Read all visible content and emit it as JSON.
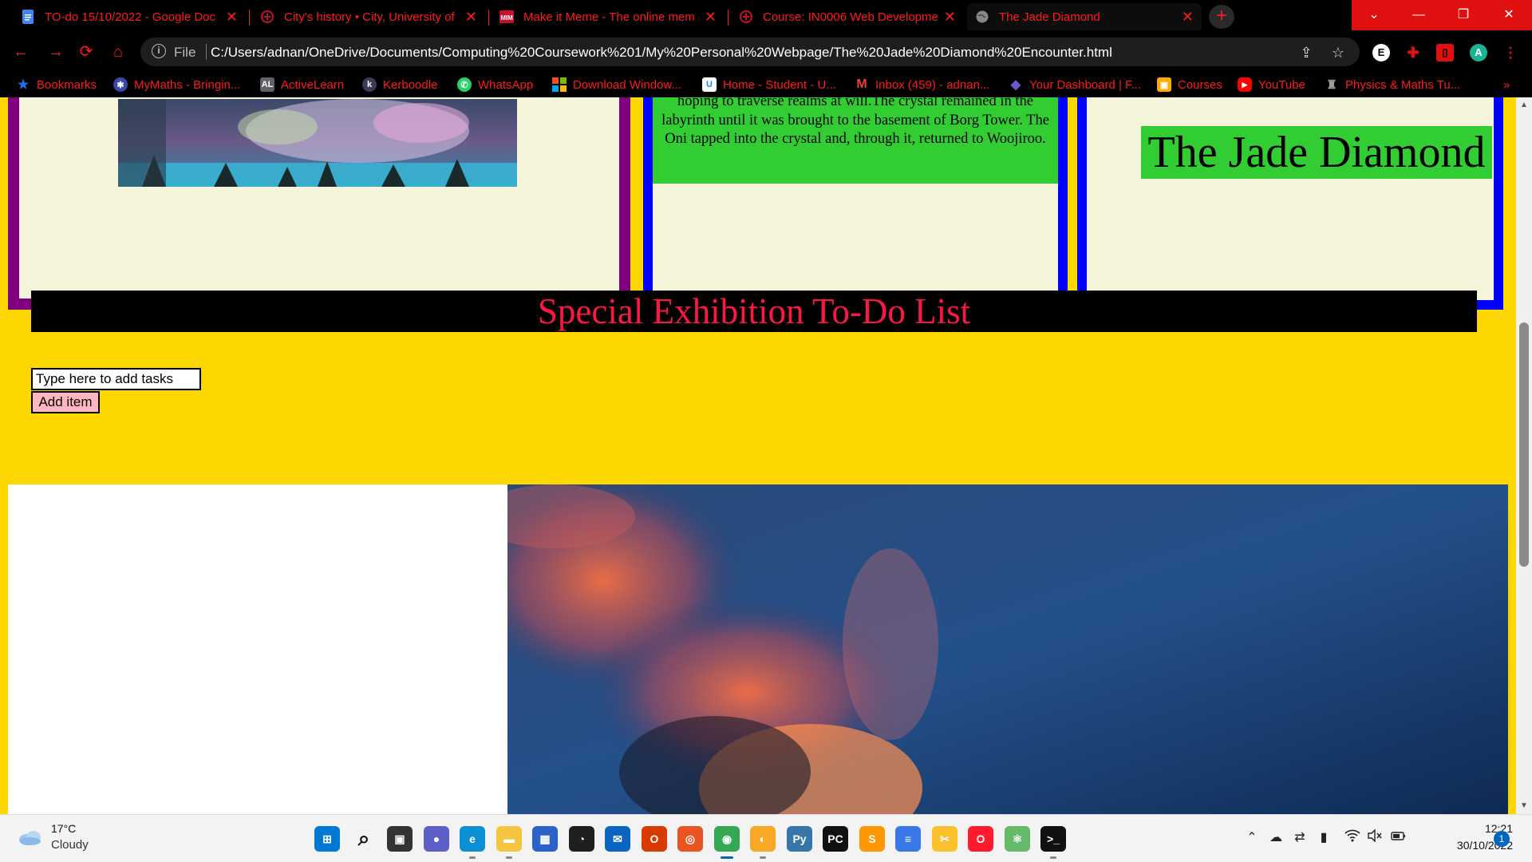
{
  "browser": {
    "tabs": [
      {
        "title": "TO-do 15/10/2022 - Google Doc",
        "icon": "google-docs-icon",
        "icon_color": "#4285f4"
      },
      {
        "title": "City's history • City, University of",
        "icon": "city-university-icon",
        "icon_color": "#c8102e"
      },
      {
        "title": "Make it Meme - The online mem",
        "icon": "makeitmeme-icon",
        "icon_color": "#c8102e"
      },
      {
        "title": "Course: IN0006 Web Developme",
        "icon": "moodle-course-icon",
        "icon_color": "#c8102e"
      },
      {
        "title": "The Jade Diamond",
        "icon": "globe-icon",
        "icon_color": "#888888"
      }
    ],
    "new_tab_label": "+",
    "window_controls": {
      "tab_search": "⌄",
      "minimize": "—",
      "restore": "❐",
      "close": "✕"
    },
    "address": {
      "scheme_label": "File",
      "url": "C:/Users/adnan/OneDrive/Documents/Computing%20Coursework%201/My%20Personal%20Webpage/The%20Jade%20Diamond%20Encounter.html"
    },
    "profile_initial": "A",
    "bookmarks": [
      {
        "label": "Bookmarks",
        "icon": "star-icon",
        "color": "#1a73e8"
      },
      {
        "label": "MyMaths - Bringin...",
        "icon": "mymaths-icon",
        "color": "#3949ab"
      },
      {
        "label": "ActiveLearn",
        "icon": "activelearn-icon",
        "color": "#5f6368"
      },
      {
        "label": "Kerboodle",
        "icon": "kerboodle-icon",
        "color": "#3a3a5a"
      },
      {
        "label": "WhatsApp",
        "icon": "whatsapp-icon",
        "color": "#25d366"
      },
      {
        "label": "Download Window...",
        "icon": "windows-logo-icon",
        "color": "#f25022"
      },
      {
        "label": "Home - Student - U...",
        "icon": "unifrog-icon",
        "color": "#1e88e5"
      },
      {
        "label": "Inbox (459) - adnan...",
        "icon": "gmail-icon",
        "color": "#ea4335"
      },
      {
        "label": "Your Dashboard | F...",
        "icon": "dashboard-icon",
        "color": "#6a5acd"
      },
      {
        "label": "Courses",
        "icon": "google-classroom-icon",
        "color": "#f9ab00"
      },
      {
        "label": "YouTube",
        "icon": "youtube-icon",
        "color": "#ff0000"
      },
      {
        "label": "Physics & Maths Tu...",
        "icon": "pmt-icon",
        "color": "#9e9e9e"
      }
    ],
    "bookmarks_overflow": "»"
  },
  "page": {
    "panel2_text": "hoping to traverse realms at will.The crystal remained in the labyrinth until it was brought to the basement of Borg Tower. The Oni tapped into the crystal and, through it, returned to Woojiroo.",
    "panel3_title": "The Jade Diamond",
    "todo": {
      "heading": "Special Exhibition To-Do List",
      "input_placeholder": "Type here to add tasks",
      "add_button": "Add item"
    }
  },
  "taskbar": {
    "weather": {
      "temp": "17°C",
      "condition": "Cloudy"
    },
    "apps": [
      {
        "name": "windows-start-icon",
        "color": "#0078d4",
        "glyph": "⊞"
      },
      {
        "name": "search-icon",
        "color": "#f3f3f3",
        "glyph": "⌕"
      },
      {
        "name": "task-view-icon",
        "color": "#333333",
        "glyph": "▣"
      },
      {
        "name": "teams-chat-icon",
        "color": "#5b5fc7",
        "glyph": "●"
      },
      {
        "name": "edge-icon",
        "color": "#0c8fd3",
        "glyph": "e"
      },
      {
        "name": "file-explorer-icon",
        "color": "#f5c542",
        "glyph": "▬"
      },
      {
        "name": "microsoft-store-icon",
        "color": "#2a62c9",
        "glyph": "▦"
      },
      {
        "name": "performance-icon",
        "color": "#1f1f1f",
        "glyph": "◔"
      },
      {
        "name": "mail-icon",
        "color": "#0a64c0",
        "glyph": "✉"
      },
      {
        "name": "office-icon",
        "color": "#d83b01",
        "glyph": "O"
      },
      {
        "name": "ubuntu-icon",
        "color": "#e95420",
        "glyph": "◎"
      },
      {
        "name": "chrome-icon",
        "color": "#34a853",
        "glyph": "◉"
      },
      {
        "name": "tor-browser-icon",
        "color": "#f9a825",
        "glyph": "◐"
      },
      {
        "name": "python-icon",
        "color": "#3776ab",
        "glyph": "Py"
      },
      {
        "name": "pycharm-icon",
        "color": "#111111",
        "glyph": "PC"
      },
      {
        "name": "sublime-text-icon",
        "color": "#ff9800",
        "glyph": "S"
      },
      {
        "name": "notepad-icon",
        "color": "#3b78e7",
        "glyph": "≡"
      },
      {
        "name": "snipping-tool-icon",
        "color": "#fbc02d",
        "glyph": "✂"
      },
      {
        "name": "opera-icon",
        "color": "#ff1b2d",
        "glyph": "O"
      },
      {
        "name": "atom-icon",
        "color": "#66bb6a",
        "glyph": "⚛"
      },
      {
        "name": "terminal-icon",
        "color": "#111111",
        "glyph": ">_"
      }
    ],
    "tray": [
      {
        "name": "chevron-up-icon",
        "glyph": "⌃"
      },
      {
        "name": "onedrive-sync-icon",
        "glyph": "☁"
      },
      {
        "name": "settings-sliders-icon",
        "glyph": "⇄"
      },
      {
        "name": "audio-levels-icon",
        "glyph": "▮"
      },
      {
        "name": "wifi-icon",
        "glyph": "◠"
      },
      {
        "name": "speaker-muted-icon",
        "glyph": "🔇"
      },
      {
        "name": "battery-icon",
        "glyph": "▭"
      }
    ],
    "clock": {
      "time": "12:21",
      "date": "30/10/2022"
    },
    "notification_count": "1"
  }
}
